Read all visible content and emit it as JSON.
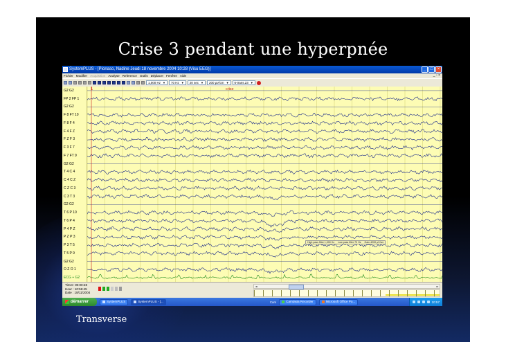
{
  "slide": {
    "title": "Crise 3 pendant une hyperpnée",
    "caption": "Transverse"
  },
  "window": {
    "title": "SystemPLUS - [Pionaso, Nadine Jeudi 18 novembre 2004 10:28 (Visu EEG)]",
    "menu": [
      "Fichier",
      "Modifier",
      "Acquisition",
      "Analyse",
      "Reference",
      "Outils",
      "Déplacer",
      "Fenêtre",
      "Aide"
    ],
    "menu_disabled": [
      false,
      false,
      true,
      false,
      false,
      false,
      false,
      false,
      false
    ],
    "toolbar": {
      "highpass": "1,000 Hz",
      "lowpass": "70 Hz",
      "timebase": "20 sec",
      "gain": "200 µV/cm",
      "montage": "6-trans.23"
    }
  },
  "eeg": {
    "marker": "1",
    "event_label": "crise",
    "filter_info": [
      "High pass filter 1,000 Hz",
      "Low pass filter 70 Hz",
      "Gain 4200 µV/cm"
    ],
    "channels": [
      {
        "label": "G2 G2",
        "kind": "ref"
      },
      {
        "label": "FP 2 FP 1",
        "kind": "eeg"
      },
      {
        "label": "G2 G2",
        "kind": "ref"
      },
      {
        "label": "F 8 FT 10",
        "kind": "eeg"
      },
      {
        "label": "F 8 F 4",
        "kind": "eeg"
      },
      {
        "label": "F 4 F Z",
        "kind": "eeg"
      },
      {
        "label": "F Z F 3",
        "kind": "eeg"
      },
      {
        "label": "F 3 F 7",
        "kind": "eeg"
      },
      {
        "label": "F 7 FT 9",
        "kind": "eeg"
      },
      {
        "label": "G2 G2",
        "kind": "ref"
      },
      {
        "label": "T 4 C 4",
        "kind": "eeg"
      },
      {
        "label": "C 4 C Z",
        "kind": "eeg"
      },
      {
        "label": "C Z C 3",
        "kind": "eeg"
      },
      {
        "label": "C 3 T 3",
        "kind": "eeg"
      },
      {
        "label": "G2 G2",
        "kind": "ref"
      },
      {
        "label": "T 6 P 10",
        "kind": "eeg"
      },
      {
        "label": "T 6 P 4",
        "kind": "eeg"
      },
      {
        "label": "P 4 P Z",
        "kind": "eeg"
      },
      {
        "label": "P Z P 3",
        "kind": "eeg"
      },
      {
        "label": "P 3 T 5",
        "kind": "eeg"
      },
      {
        "label": "T 5 P 9",
        "kind": "eeg"
      },
      {
        "label": "G2 G2",
        "kind": "ref"
      },
      {
        "label": "O Z O 1",
        "kind": "eeg"
      },
      {
        "label": "ECG + G2",
        "kind": "ecg"
      }
    ]
  },
  "status": {
    "timer": "Timer: 00:00:28",
    "hour": "Hour : 10:56:45",
    "date": "Date : 18/11/2004"
  },
  "taskbar": {
    "start": "démarrer",
    "tasks": [
      "SystemPLUS",
      "SystemPLUS - [...",
      "Camtasia Recorder",
      "Microsoft Office Po..."
    ],
    "tray_label": "Cam",
    "clock": "10:57"
  },
  "colors": {
    "eeg_background": "#fdfcb4",
    "trace": "#1a2a8a",
    "event": "#c81a1a",
    "ecg": "#1a8a1a"
  }
}
